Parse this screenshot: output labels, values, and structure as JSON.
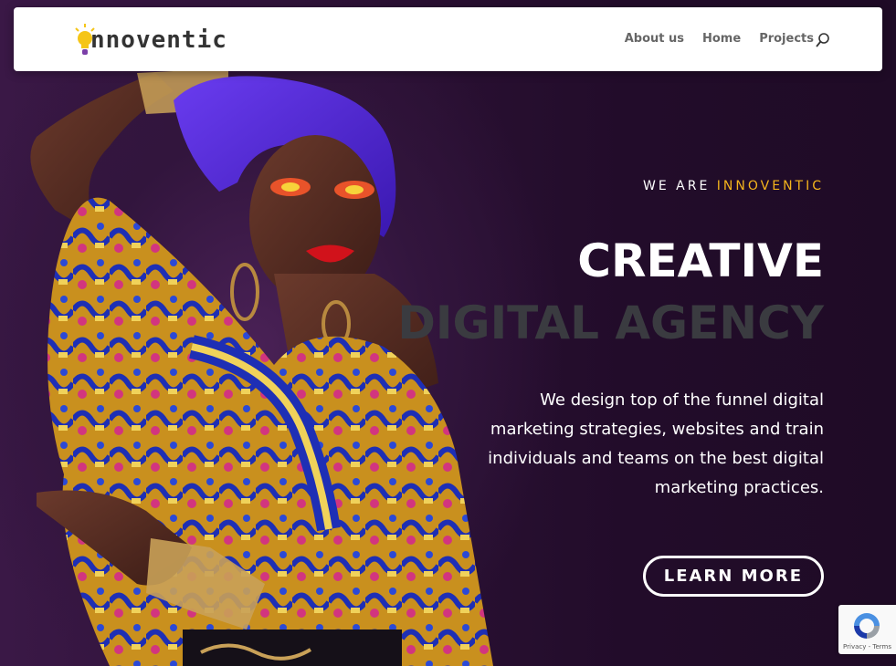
{
  "brand": {
    "name": "nnoventic",
    "bulb_color": "#f5c518"
  },
  "nav": {
    "items": [
      "About us",
      "Home",
      "Projects"
    ]
  },
  "hero": {
    "kicker_prefix": "WE ARE",
    "kicker_accent": "INNOVENTIC",
    "title_line1": "CREATIVE",
    "title_line2": "DIGITAL AGENCY",
    "description": "We design top of the funnel digital marketing strategies, websites and train individuals and teams on the best digital marketing practices.",
    "cta_label": "LEARN MORE",
    "accent_color": "#f5b51c"
  },
  "recaptcha": {
    "links": "Privacy - Terms"
  }
}
